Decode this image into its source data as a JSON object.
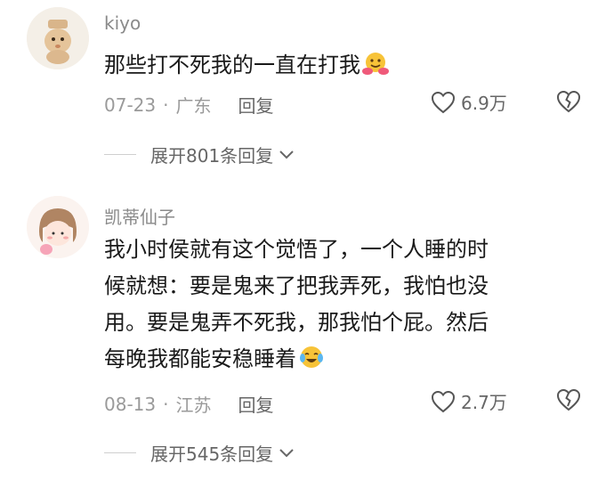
{
  "comments": [
    {
      "username": "kiyo",
      "text": "那些打不死我的一直在打我",
      "emoji": "hugging-face-emoji",
      "date": "07-23",
      "location": "广东",
      "reply_label": "回复",
      "likes": "6.9万",
      "expand_label": "展开801条回复"
    },
    {
      "username": "凯蒂仙子",
      "text": "我小时侯就有这个觉悟了，一个人睡的时\n候就想：要是鬼来了把我弄死，我怕也没\n用。要是鬼弄不死我，那我怕个屁。然后\n每晚我都能安稳睡着",
      "emoji": "crying-laughing-emoji",
      "date": "08-13",
      "location": "江苏",
      "reply_label": "回复",
      "likes": "2.7万",
      "expand_label": "展开545条回复"
    }
  ],
  "separator": "·",
  "colors": {
    "meta": "#9a9a9a",
    "text": "#1a1a1a",
    "accent": "#666666"
  }
}
